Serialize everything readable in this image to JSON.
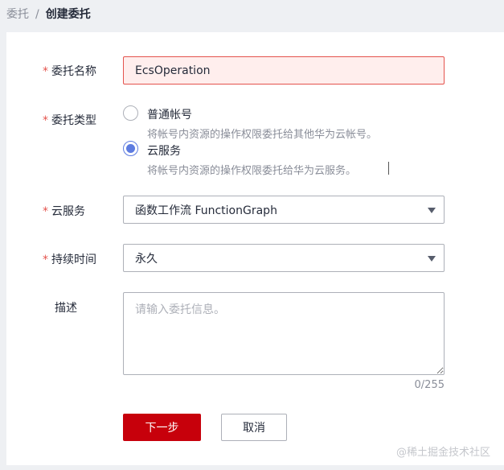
{
  "breadcrumb": {
    "parent": "委托",
    "separator": "/",
    "current": "创建委托"
  },
  "form": {
    "name": {
      "label": "委托名称",
      "value": "EcsOperation",
      "required": true
    },
    "type": {
      "label": "委托类型",
      "options": [
        {
          "label": "普通帐号",
          "desc": "将帐号内资源的操作权限委托给其他华为云帐号。",
          "selected": false
        },
        {
          "label": "云服务",
          "desc": "将帐号内资源的操作权限委托给华为云服务。",
          "selected": true
        }
      ]
    },
    "service": {
      "label": "云服务",
      "value": "函数工作流 FunctionGraph"
    },
    "duration": {
      "label": "持续时间",
      "value": "永久"
    },
    "description": {
      "label": "描述",
      "placeholder": "请输入委托信息。",
      "value": "",
      "counter": "0/255"
    },
    "required_mark": "*"
  },
  "buttons": {
    "next": "下一步",
    "cancel": "取消"
  },
  "watermark": "@稀土掘金技术社区",
  "colors": {
    "primary": "#c7000b",
    "radio": "#5e7ce0",
    "error_bg": "#ffeeed",
    "error_border": "#e4534d"
  }
}
